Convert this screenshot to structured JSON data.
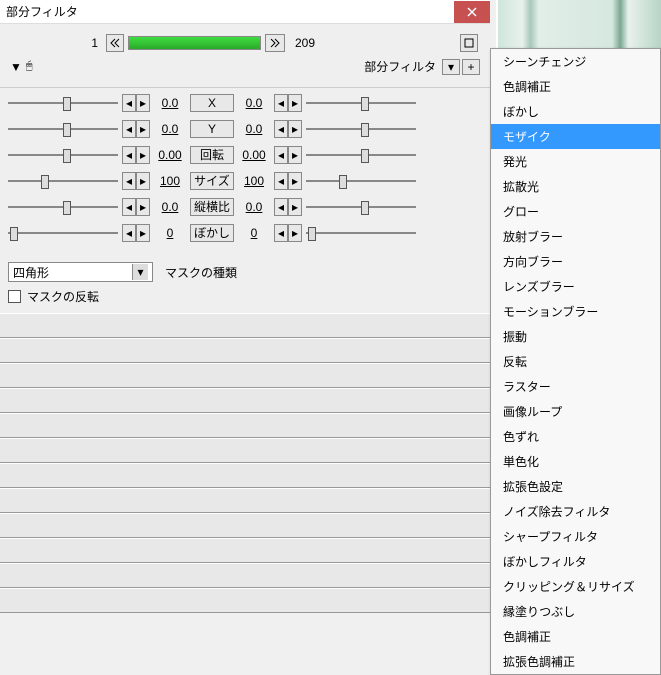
{
  "window": {
    "title": "部分フィルタ"
  },
  "frame": {
    "current": "1",
    "total": "209"
  },
  "sublabel": "部分フィルタ",
  "params": [
    {
      "label": "X",
      "left_val": "0.0",
      "right_val": "0.0",
      "lpos": 50,
      "rpos": 50
    },
    {
      "label": "Y",
      "left_val": "0.0",
      "right_val": "0.0",
      "lpos": 50,
      "rpos": 50
    },
    {
      "label": "回転",
      "left_val": "0.00",
      "right_val": "0.00",
      "lpos": 50,
      "rpos": 50
    },
    {
      "label": "サイズ",
      "left_val": "100",
      "right_val": "100",
      "lpos": 30,
      "rpos": 30
    },
    {
      "label": "縦横比",
      "left_val": "0.0",
      "right_val": "0.0",
      "lpos": 50,
      "rpos": 50
    },
    {
      "label": "ぼかし",
      "left_val": "0",
      "right_val": "0",
      "lpos": 2,
      "rpos": 2
    }
  ],
  "mask": {
    "dropdown": "四角形",
    "type_label": "マスクの種類",
    "invert_label": "マスクの反転"
  },
  "menu": {
    "items": [
      "シーンチェンジ",
      "色調補正",
      "ぼかし",
      "モザイク",
      "発光",
      "拡散光",
      "グロー",
      "放射ブラー",
      "方向ブラー",
      "レンズブラー",
      "モーションブラー",
      "振動",
      "反転",
      "ラスター",
      "画像ループ",
      "色ずれ",
      "単色化",
      "拡張色設定",
      "ノイズ除去フィルタ",
      "シャープフィルタ",
      "ぼかしフィルタ",
      "クリッピング＆リサイズ",
      "縁塗りつぶし",
      "色調補正",
      "拡張色調補正"
    ],
    "selected": 3
  }
}
